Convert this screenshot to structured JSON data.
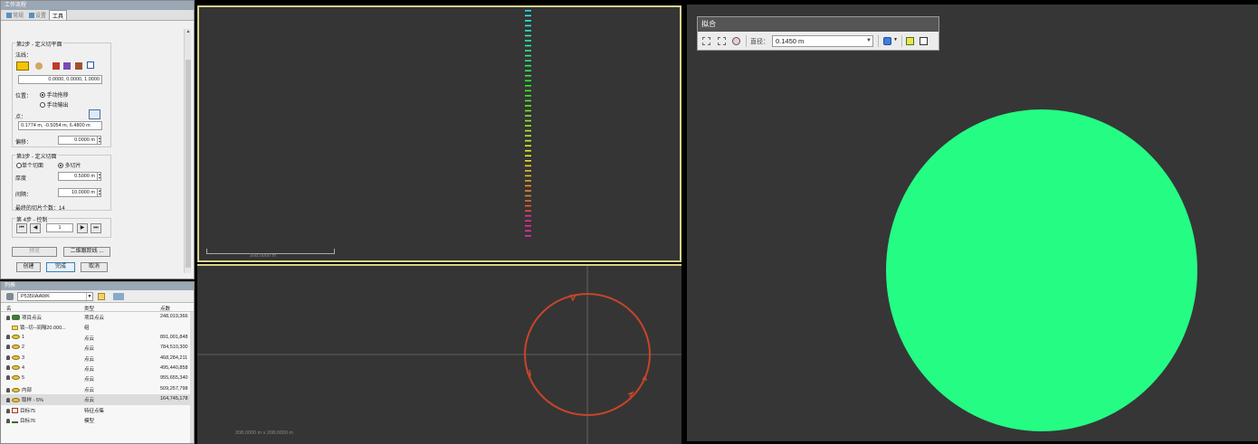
{
  "work_panel": {
    "title": "工作流程",
    "tabs": [
      {
        "label": "常规",
        "active": false
      },
      {
        "label": "设置",
        "active": false
      },
      {
        "label": "工具",
        "active": true
      }
    ],
    "step2": {
      "title": "第2步 - 定义切平面",
      "normal_label": "法线：",
      "normal_value": "0.0000, 0.0000, 1.0000",
      "position_label": "位置：",
      "position_options": [
        {
          "label": "手动拖移",
          "selected": true
        },
        {
          "label": "手动输出",
          "selected": false
        }
      ],
      "point_label": "点：",
      "point_value": "0.1774 m, -0.5054 m, 6.4800 m",
      "offset_label": "偏移：",
      "offset_value": "0.0000 m"
    },
    "step3": {
      "title": "第3步 - 定义切面",
      "mode_options": [
        {
          "label": "单个切面",
          "selected": false
        },
        {
          "label": "多切片",
          "selected": true
        }
      ],
      "thickness_label": "厚度",
      "thickness_value": "0.5000 m",
      "spacing_label": "间隔：",
      "spacing_value": "10.0000 m",
      "slice_count_label": "最终的切片个数：",
      "slice_count_value": "14"
    },
    "step4": {
      "title": "第 4步 - 控制",
      "nav_first": "⏮",
      "nav_prev": "◀",
      "index_value": "1",
      "nav_next": "▶",
      "nav_last": "⏭"
    },
    "buttons": {
      "preview": "预览",
      "two_d_tracking": "二维跟踪线 ...",
      "create": "创建",
      "finish": "完成",
      "cancel": "取消"
    }
  },
  "list_panel": {
    "title": "列表",
    "combo_value": "P535IIAAWK",
    "columns": [
      "名",
      "类型",
      "点数"
    ],
    "rows": [
      {
        "name": "项目点云",
        "type": "项目点云",
        "count": "248,019,366",
        "icon": "project"
      },
      {
        "name": "锁--切--间隔20.000...",
        "type": "组",
        "count": "",
        "icon": "folder"
      },
      {
        "name": "1",
        "type": "点云",
        "count": "891,001,848",
        "icon": "cloud"
      },
      {
        "name": "2",
        "type": "点云",
        "count": "784,510,300",
        "icon": "cloud"
      },
      {
        "name": "3",
        "type": "点云",
        "count": "468,284,211",
        "icon": "cloud"
      },
      {
        "name": "4",
        "type": "点云",
        "count": "495,440,858",
        "icon": "cloud"
      },
      {
        "name": "5",
        "type": "点云",
        "count": "955,655,340",
        "icon": "cloud"
      },
      {
        "name": "内部",
        "type": "点云",
        "count": "509,257,798",
        "icon": "cloud"
      },
      {
        "name": "取样 - 5%",
        "type": "点云",
        "count": "164,745,178",
        "icon": "cloud",
        "selected": true
      },
      {
        "name": "目标75",
        "type": "特征点集",
        "count": "",
        "icon": "target"
      },
      {
        "name": "目标76",
        "type": "模型",
        "count": "",
        "icon": "model"
      }
    ]
  },
  "viewport_top": {
    "scale_label": "208.0000 m"
  },
  "viewport_bottom": {
    "scale_label": "208.0000 m x 208.0000 m"
  },
  "fit_panel": {
    "title": "拟合",
    "diameter_label": "直径：",
    "diameter_value": "0.1450 m",
    "circle_color": "#25fc84"
  }
}
